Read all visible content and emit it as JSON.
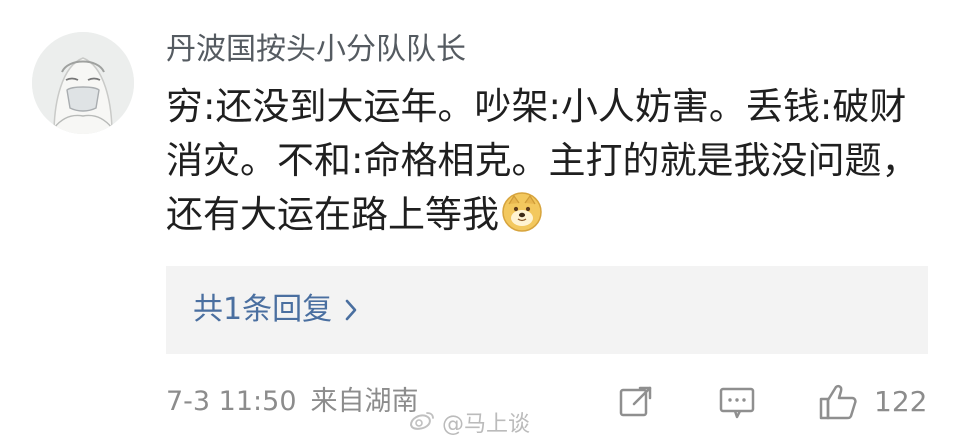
{
  "comment": {
    "username": "丹波国按头小分队队长",
    "text": "穷:还没到大运年。吵架:小人妨害。丢钱:破财消灾。不和:命格相克。主打的就是我没问题，还有大运在路上等我",
    "emoji": "doge-emoji"
  },
  "reply": {
    "label": "共1条回复",
    "chevron": "chevron-right-icon"
  },
  "footer": {
    "time": "7-3 11:50",
    "source": "来自湖南",
    "share_icon": "share-icon",
    "comment_icon": "comment-icon",
    "like_icon": "thumbs-up-icon",
    "like_count": "122"
  },
  "watermark": {
    "text": "@马上谈",
    "icon": "weibo-logo-icon"
  },
  "colors": {
    "username": "#555b61",
    "text": "#1f1f1f",
    "link": "#4a6fa0",
    "meta": "#8c8c8c",
    "reply_bg": "#f3f3f3"
  }
}
